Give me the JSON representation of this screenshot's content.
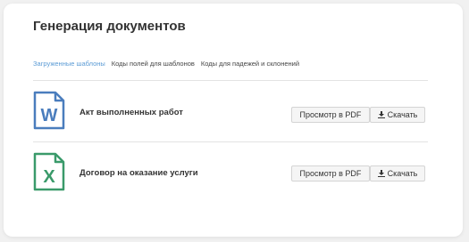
{
  "page": {
    "title": "Генерация документов"
  },
  "tabs": [
    {
      "label": "Загруженные шаблоны",
      "active": true
    },
    {
      "label": "Коды полей для шаблонов",
      "active": false
    },
    {
      "label": "Коды для падежей и склонений",
      "active": false
    }
  ],
  "documents": [
    {
      "name": "Акт выполненных работ",
      "icon": "word-file-icon",
      "icon_letter": "W",
      "color": "#4a7dbd",
      "preview_label": "Просмотр в PDF",
      "download_label": "Скачать"
    },
    {
      "name": "Договор на оказание услуги",
      "icon": "excel-file-icon",
      "icon_letter": "X",
      "color": "#3a9a6a",
      "preview_label": "Просмотр в PDF",
      "download_label": "Скачать"
    }
  ]
}
